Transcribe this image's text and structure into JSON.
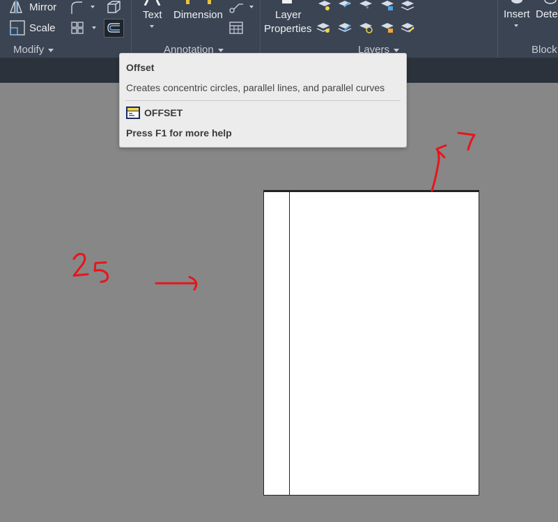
{
  "ribbon": {
    "modify": {
      "mirror_label": "Mirror",
      "scale_label": "Scale",
      "panel_title": "Modify"
    },
    "annotation": {
      "text_label": "Text",
      "dimension_label": "Dimension",
      "panel_title": "Annotation"
    },
    "layers": {
      "layer_properties_line1": "Layer",
      "layer_properties_line2": "Properties",
      "panel_title": "Layers"
    },
    "block": {
      "insert_label": "Insert",
      "detect_label": "Dete",
      "panel_title": "Block"
    }
  },
  "tooltip": {
    "title": "Offset",
    "description": "Creates concentric circles, parallel lines, and parallel curves",
    "command": "OFFSET",
    "help": "Press F1 for more help"
  },
  "annotations": {
    "left_value": "25",
    "top_value": "7"
  },
  "colors": {
    "ribbon_bg": "#3b4453",
    "canvas_bg": "#878787",
    "annotation_red": "#e8151b"
  }
}
